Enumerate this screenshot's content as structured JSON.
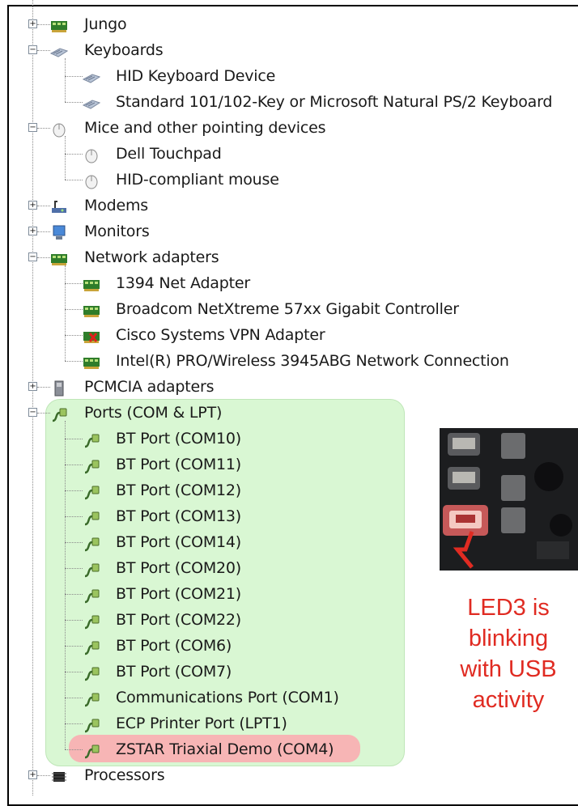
{
  "device_tree": {
    "categories": [
      {
        "label": "Jungo",
        "icon": "network-card-icon",
        "expanded": false
      },
      {
        "label": "Keyboards",
        "icon": "keyboard-icon",
        "expanded": true,
        "children": [
          "HID Keyboard Device",
          "Standard 101/102-Key or Microsoft Natural PS/2 Keyboard"
        ]
      },
      {
        "label": "Mice and other pointing devices",
        "icon": "mouse-icon",
        "expanded": true,
        "children": [
          "Dell Touchpad",
          "HID-compliant mouse"
        ]
      },
      {
        "label": "Modems",
        "icon": "modem-icon",
        "expanded": false
      },
      {
        "label": "Monitors",
        "icon": "monitor-icon",
        "expanded": false
      },
      {
        "label": "Network adapters",
        "icon": "network-card-icon",
        "expanded": true,
        "children": [
          "1394 Net Adapter",
          "Broadcom NetXtreme 57xx Gigabit Controller",
          "Cisco Systems VPN Adapter",
          "Intel(R) PRO/Wireless 3945ABG Network Connection"
        ]
      },
      {
        "label": "PCMCIA adapters",
        "icon": "pcmcia-icon",
        "expanded": false
      },
      {
        "label": "Ports (COM & LPT)",
        "icon": "port-icon",
        "expanded": true,
        "children": [
          "BT Port (COM10)",
          "BT Port (COM11)",
          "BT Port (COM12)",
          "BT Port (COM13)",
          "BT Port (COM14)",
          "BT Port (COM20)",
          "BT Port (COM21)",
          "BT Port (COM22)",
          "BT Port (COM6)",
          "BT Port (COM7)",
          "Communications Port (COM1)",
          "ECP Printer Port (LPT1)",
          "ZSTAR Triaxial Demo (COM4)"
        ]
      },
      {
        "label": "Processors",
        "icon": "processor-icon",
        "expanded": false
      }
    ],
    "highlighted_device": "ZSTAR Triaxial Demo (COM4)",
    "disabled_device": "Cisco Systems VPN Adapter"
  },
  "annotation": {
    "lines": [
      "LED3 is",
      "blinking",
      "with USB",
      "activity"
    ],
    "color": "#e02b22"
  },
  "colors": {
    "ports_highlight": "#d9f7d3",
    "device_highlight": "#f7b5b5"
  }
}
